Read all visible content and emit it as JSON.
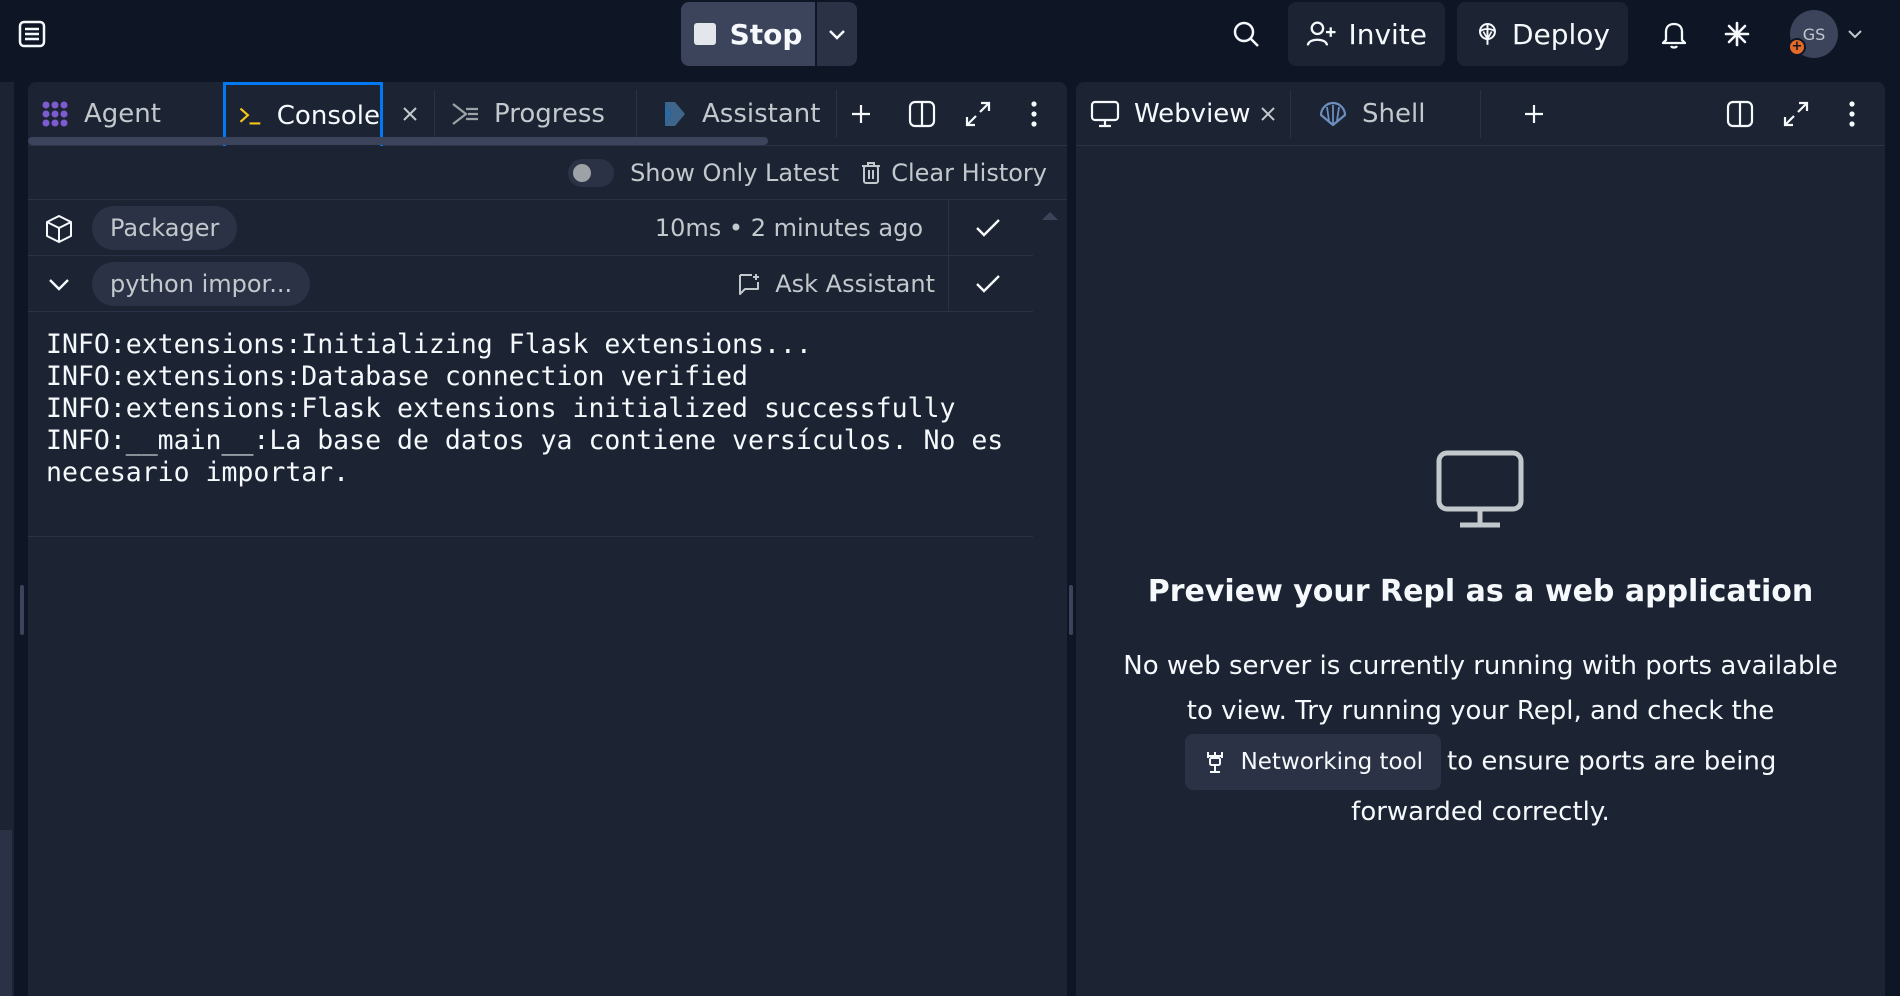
{
  "topbar": {
    "stop_label": "Stop",
    "invite_label": "Invite",
    "deploy_label": "Deploy",
    "avatar_initials": "GS",
    "avatar_badge": "+"
  },
  "left_tabs": {
    "agent": "Agent",
    "console": "Console",
    "progress": "Progress",
    "assistant": "Assistant"
  },
  "console": {
    "show_only_latest": "Show Only Latest",
    "clear_history": "Clear History",
    "entries": [
      {
        "chip": "Packager",
        "meta": "10ms • 2 minutes ago"
      },
      {
        "chip": "python impor...",
        "action": "Ask Assistant"
      }
    ],
    "output": [
      "INFO:extensions:Initializing Flask extensions...",
      "INFO:extensions:Database connection verified",
      "INFO:extensions:Flask extensions initialized successfully",
      "INFO:__main__:La base de datos ya contiene versículos. No es necesario importar."
    ]
  },
  "right_tabs": {
    "webview": "Webview",
    "shell": "Shell"
  },
  "preview": {
    "title": "Preview your Repl as a web application",
    "text_before": "No web server is currently running with ports available to view. Try running your Repl, and check the",
    "networking_tool": "Networking tool",
    "text_after": "to ensure ports are being forwarded correctly."
  },
  "colors": {
    "background": "#0e1525",
    "surface": "#1c2333",
    "active_tab_border": "#0079f2",
    "agent_icon": "#7d5bd0",
    "console_icon": "#f5c518",
    "assistant_icon": "#5a9ed1",
    "shell_icon": "#6d8fbf"
  }
}
